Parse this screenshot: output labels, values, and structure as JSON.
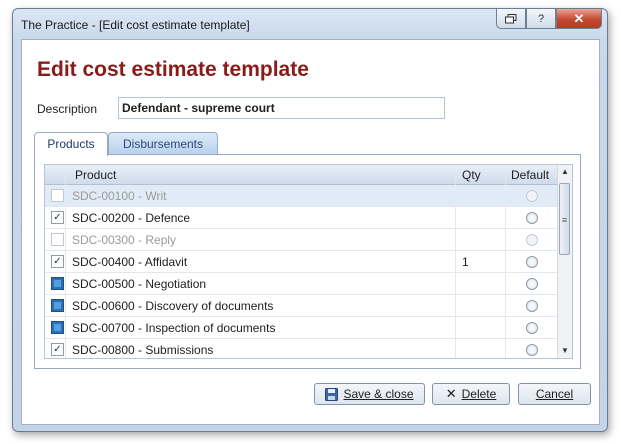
{
  "window": {
    "title": "The Practice - [Edit cost estimate template]",
    "buttons": [
      "restore-icon",
      "help",
      "close"
    ],
    "help_label": "?",
    "close_label": "✕"
  },
  "heading": "Edit cost estimate template",
  "description": {
    "label": "Description",
    "value": "Defendant - supreme court"
  },
  "tabs": [
    {
      "label": "Products",
      "active": true
    },
    {
      "label": "Disbursements",
      "active": false
    }
  ],
  "grid": {
    "columns": {
      "product": "Product",
      "qty": "Qty",
      "default": "Default"
    },
    "rows": [
      {
        "product": "SDC-00100 - Writ",
        "checked": false,
        "enabled": false,
        "qty": "",
        "selected": true
      },
      {
        "product": "SDC-00200 - Defence",
        "checked": true,
        "enabled": true,
        "qty": "",
        "selected": false
      },
      {
        "product": "SDC-00300 - Reply",
        "checked": false,
        "enabled": false,
        "qty": "",
        "selected": false
      },
      {
        "product": "SDC-00400 - Affidavit",
        "checked": true,
        "enabled": true,
        "qty": "1",
        "selected": false
      },
      {
        "product": "SDC-00500 - Negotiation",
        "checked": "indeterminate",
        "enabled": true,
        "qty": "",
        "selected": false
      },
      {
        "product": "SDC-00600 - Discovery of documents",
        "checked": "indeterminate",
        "enabled": true,
        "qty": "",
        "selected": false
      },
      {
        "product": "SDC-00700 - Inspection of documents",
        "checked": "indeterminate",
        "enabled": true,
        "qty": "",
        "selected": false
      },
      {
        "product": "SDC-00800 - Submissions",
        "checked": true,
        "enabled": true,
        "qty": "",
        "selected": false
      }
    ]
  },
  "buttons": {
    "save": "Save & close",
    "delete": "Delete",
    "cancel": "Cancel"
  },
  "colors": {
    "heading": "#8b1a1a",
    "accent": "#2d6fb0"
  }
}
